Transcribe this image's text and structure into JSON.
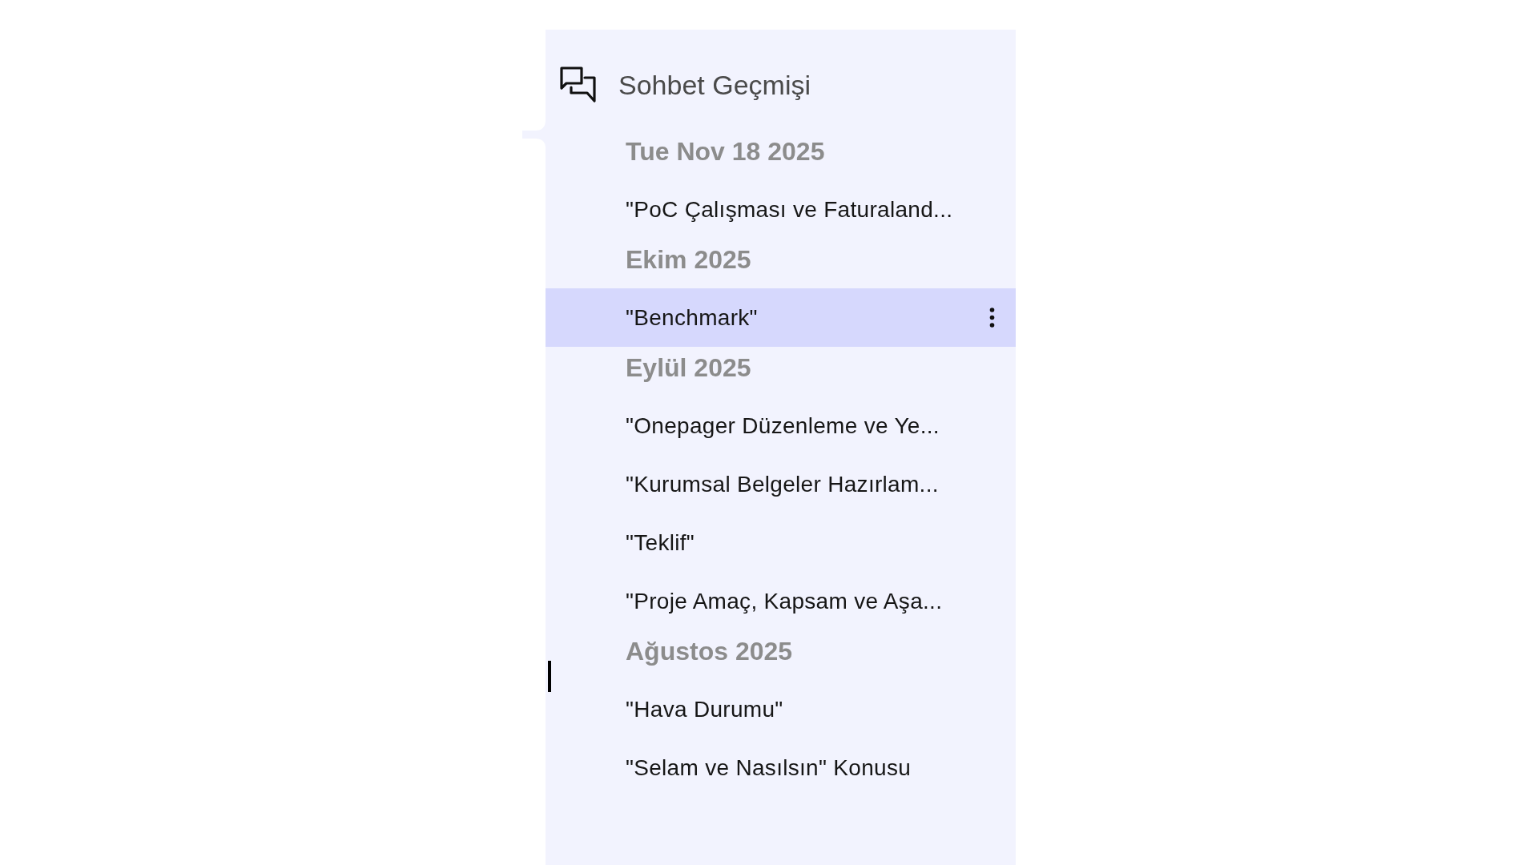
{
  "panel": {
    "title": "Sohbet Geçmişi"
  },
  "groups": [
    {
      "label": "Tue Nov 18 2025",
      "chats": [
        {
          "title": "\"PoC Çalışması ve Faturaland...",
          "selected": false
        }
      ]
    },
    {
      "label": "Ekim 2025",
      "chats": [
        {
          "title": "\"Benchmark\"",
          "selected": true
        }
      ]
    },
    {
      "label": "Eylül 2025",
      "chats": [
        {
          "title": "\"Onepager Düzenleme ve Ye...",
          "selected": false
        },
        {
          "title": "\"Kurumsal Belgeler Hazırlam...",
          "selected": false
        },
        {
          "title": "\"Teklif\"",
          "selected": false
        },
        {
          "title": "\"Proje Amaç, Kapsam ve Aşa...",
          "selected": false
        }
      ]
    },
    {
      "label": "Ağustos 2025",
      "chats": [
        {
          "title": "\"Hava Durumu\"",
          "selected": false
        },
        {
          "title": "\"Selam ve Nasılsın\" Konusu",
          "selected": false
        }
      ]
    }
  ]
}
